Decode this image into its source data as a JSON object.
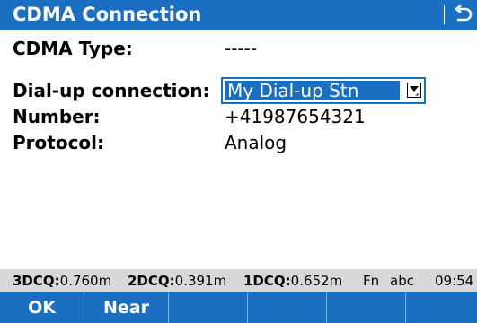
{
  "window": {
    "title": "CDMA Connection"
  },
  "fields": {
    "cdma_type_label": "CDMA Type:",
    "cdma_type_value": "-----",
    "dialup_label": "Dial-up connection:",
    "dialup_value": "My Dial-up Stn",
    "number_label": "Number:",
    "number_value": "+41987654321",
    "protocol_label": "Protocol:",
    "protocol_value": "Analog"
  },
  "status": {
    "q3_label": "3DCQ:",
    "q3_value": "0.760m",
    "q2_label": "2DCQ:",
    "q2_value": "0.391m",
    "q1_label": "1DCQ:",
    "q1_value": "0.652m",
    "fn": "Fn",
    "input_mode": "abc",
    "time": "09:54"
  },
  "softkeys": [
    "OK",
    "Near",
    "",
    "",
    "",
    ""
  ],
  "icons": {
    "back": "back-arrow-icon",
    "dropdown": "dropdown-arrow-icon"
  },
  "colors": {
    "accent": "#1a6fc2",
    "status_bg": "#d8d8d8"
  }
}
